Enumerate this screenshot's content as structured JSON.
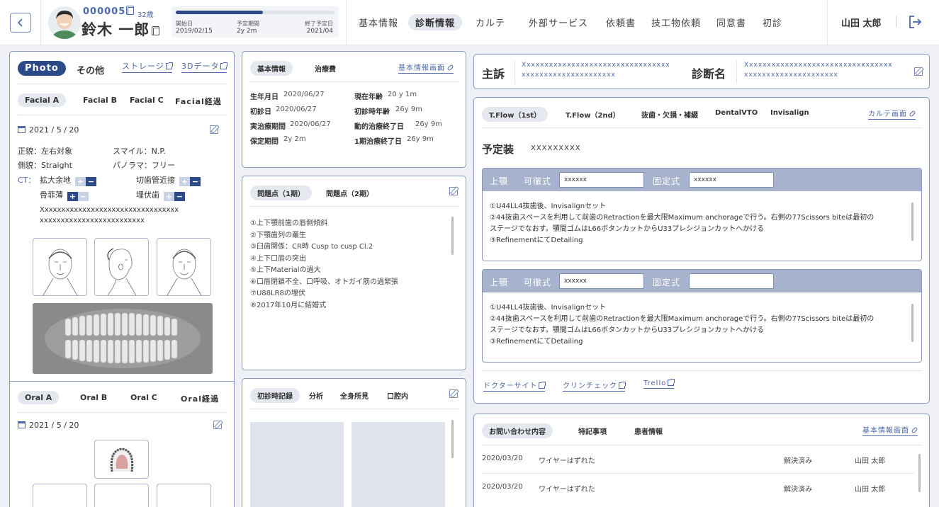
{
  "header": {
    "patient_id": "000005",
    "age": "32歳",
    "name": "鈴木 一郎",
    "progress": {
      "value": 0.55,
      "start_label": "開始日",
      "start_value": "2019/02/15",
      "period_label": "予定期間",
      "period_value": "2y 2m",
      "end_label": "終了予定日",
      "end_value": "2021/04"
    },
    "nav": [
      {
        "label": "基本情報"
      },
      {
        "label": "診断情報"
      },
      {
        "label": "カルテ"
      },
      {
        "label": "外部サービス"
      },
      {
        "label": "依頼書"
      },
      {
        "label": "技工物依頼"
      },
      {
        "label": "同意書"
      },
      {
        "label": "初診"
      }
    ],
    "user": "山田 太郎"
  },
  "photo": {
    "tab_photo": "Photo",
    "tab_other": "その他",
    "link_storage": "ストレージ",
    "link_3d": "3Dデータ",
    "facial_tabs": [
      "Facial A",
      "Facial B",
      "Facial C",
      "Facial経過"
    ],
    "date": "2021 / 5 / 20",
    "front": "正貌：左右対象",
    "smile": "スマイル：N.P.",
    "side": "側貌：Straight",
    "panorama": "パノラマ：フリー",
    "ct": "CT：",
    "ct_kakudai": "拡大余地",
    "ct_setsu": "切歯管近接",
    "ct_kotsu": "骨菲薄",
    "ct_maifuku": "埋伏歯",
    "plus": "+",
    "minus": "−",
    "note": [
      "Xxxxxxxxxxxxxxxxxxxxxxxxxxxxxxxxx",
      "xxxxxxxxxxxxxxxxxxxxxxxxx"
    ],
    "oral_tabs": [
      "Oral A",
      "Oral B",
      "Oral C",
      "Oral経過"
    ],
    "oral_date": "2021 / 5 / 20"
  },
  "basic": {
    "tab1": "基本情報",
    "tab2": "治療費",
    "link": "基本情報画面",
    "rows": [
      {
        "l1": "生年月日",
        "v1": "2020/06/27",
        "l2": "現在年齢",
        "v2": "20 y 1m"
      },
      {
        "l1": "初診日",
        "v1": "2020/06/27",
        "l2": "初診時年齢",
        "v2": "26y 9m"
      },
      {
        "l1": "実治療期間",
        "v1": "2020/06/27",
        "l2": "動的治療終了日",
        "v2": "26y 9m"
      },
      {
        "l1": "保定期間",
        "v1": "2y 2m",
        "l2": "1期治療終了日",
        "v2": "26y 9m"
      }
    ]
  },
  "problems": {
    "tab1": "問題点（1期）",
    "tab2": "問題点（2期）",
    "items": [
      "①上下顎前歯の唇側傾斜",
      "②下顎歯列の叢生",
      "③臼歯関係：CR時 Cusp to cusp Cl.2",
      "④上下口唇の突出",
      "⑤上下Materialの過大",
      "⑥口唇閉鎖不全、口呼吸、オトガイ筋の過緊張",
      "⑦U88LR8の埋伏",
      "⑧2017年10月に結婚式"
    ]
  },
  "firstvisit": {
    "tabs": [
      "初診時記録",
      "分析",
      "全身所見",
      "口腔内"
    ]
  },
  "complaint": {
    "label": "主訴",
    "text": [
      "Xxxxxxxxxxxxxxxxxxxxxxxxxxxxxxxxx",
      "xxxxxxxxxxxxxxxxxxxxx"
    ],
    "diag_label": "診断名",
    "diag_text": [
      "Xxxxxxxxxxxxxxxxxxxxxxxxxxxxxxxxx",
      "xxxxxxxxxxxxxxxxxxxxx"
    ]
  },
  "tflow": {
    "tabs": [
      "T.Flow（1st）",
      "T.Flow（2nd）",
      "抜歯・欠損・補綴",
      "DentalVTO",
      "Invisalign"
    ],
    "link": "カルテ画面",
    "planned_label": "予定装",
    "planned_value": "XXXXXXXXX",
    "sections": [
      {
        "jaw": "上顎",
        "removable": "可徹式",
        "removable_value": "xxxxxx",
        "fixed": "固定式",
        "fixed_value": "xxxxxx",
        "lines": [
          "①U44LL4抜歯後、Invisalignセット",
          "②44抜歯スペースを利用して前歯のRetractionを最大限Maximum anchorageで行う。右側の77Scissors biteは最初の",
          "ステージでなおす。顎間ゴムはL66ボタンカットからU33プレシジョンカットへかける",
          "③RefinementにてDetailing"
        ]
      },
      {
        "jaw": "上顎",
        "removable": "可徹式",
        "removable_value": "xxxxxx",
        "fixed": "固定式",
        "fixed_value": "",
        "lines": [
          "①U44LL4抜歯後、Invisalignセット",
          "②44抜歯スペースを利用して前歯のRetractionを最大限Maximum anchorageで行う。右側の77Scissors biteは最初の",
          "ステージでなおす。顎間ゴムはL66ボタンカットからU33プレシジョンカットへかける",
          "③RefinementにてDetailing"
        ]
      }
    ],
    "links": [
      "ドクターサイト",
      "クリンチェック",
      "Trello"
    ]
  },
  "inquiry": {
    "tabs": [
      "お問い合わせ内容",
      "特記事項",
      "患者情報"
    ],
    "link": "基本情報画面",
    "rows": [
      {
        "date": "2020/03/20",
        "text": "ワイヤーはずれた",
        "status": "解決済み",
        "person": "山田 太郎"
      },
      {
        "date": "2020/03/20",
        "text": "ワイヤーはずれた",
        "status": "解決済み",
        "person": "山田 太郎"
      }
    ]
  }
}
